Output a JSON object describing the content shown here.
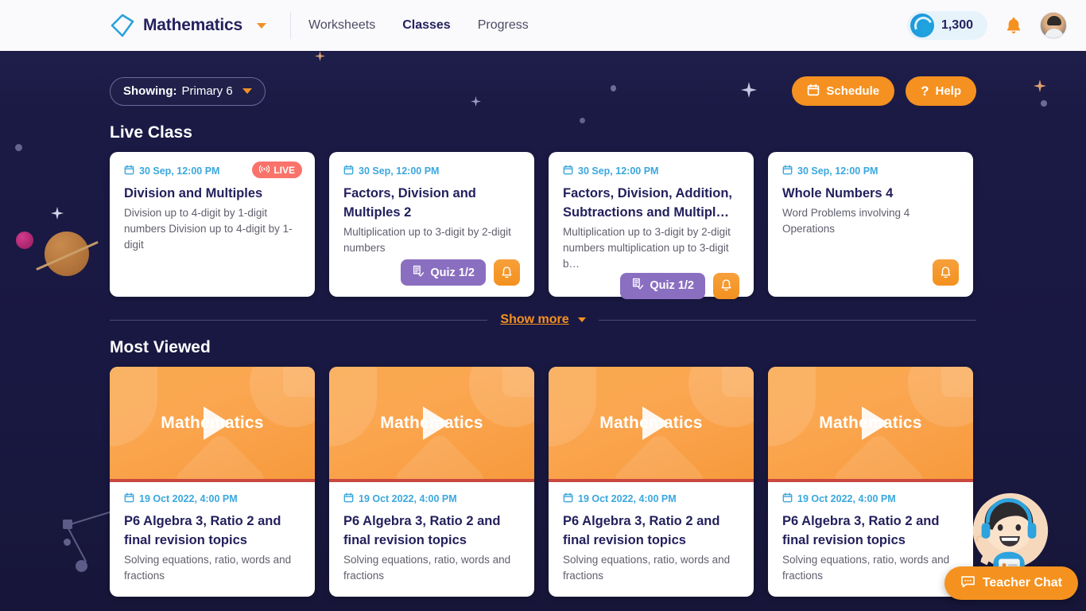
{
  "header": {
    "logo_icon": "diamond-logo-icon",
    "brand_title": "Mathematics",
    "brand_caret_icon": "chevron-down-icon",
    "nav": [
      {
        "label": "Worksheets",
        "active": false
      },
      {
        "label": "Classes",
        "active": true
      },
      {
        "label": "Progress",
        "active": false
      }
    ],
    "coins": {
      "icon": "coin-icon",
      "value": "1,300"
    },
    "notifications_icon": "bell-icon",
    "avatar_icon": "user-avatar"
  },
  "toolbar": {
    "showing_label": "Showing:",
    "showing_value": "Primary 6",
    "showing_caret_icon": "chevron-down-icon",
    "schedule_label": "Schedule",
    "schedule_icon": "calendar-icon",
    "help_label": "Help",
    "help_icon": "question-mark-icon"
  },
  "live_section": {
    "title": "Live Class",
    "cards": [
      {
        "date": "30 Sep, 12:00 PM",
        "title": "Division and Multiples",
        "desc": "Division up to 4-digit by 1-digit numbers Division up to 4-digit by 1-digit",
        "live_badge": "LIVE",
        "quiz_label": null,
        "has_bell": false
      },
      {
        "date": "30 Sep, 12:00 PM",
        "title": "Factors, Division and Multiples 2",
        "desc": "Multiplication up to 3-digit by 2-digit numbers",
        "live_badge": null,
        "quiz_label": "Quiz 1/2",
        "has_bell": true
      },
      {
        "date": "30 Sep, 12:00 PM",
        "title": "Factors, Division, Addition, Subtractions and Multipl…",
        "desc": "Multiplication up to 3-digit by 2-digit numbers multiplication up to 3-digit b…",
        "live_badge": null,
        "quiz_label": "Quiz 1/2",
        "has_bell": true
      },
      {
        "date": "30 Sep, 12:00 PM",
        "title": "Whole Numbers 4",
        "desc": "Word Problems involving 4 Operations",
        "live_badge": null,
        "quiz_label": null,
        "has_bell": true
      }
    ]
  },
  "show_more": {
    "label": "Show more",
    "caret_icon": "chevron-down-icon"
  },
  "most_viewed": {
    "title": "Most Viewed",
    "cards": [
      {
        "thumb_text": "Mathematics",
        "date": "19 Oct 2022, 4:00 PM",
        "title": "P6 Algebra 3, Ratio 2 and final revision topics",
        "desc": "Solving equations, ratio, words and fractions"
      },
      {
        "thumb_text": "Mathematics",
        "date": "19 Oct 2022, 4:00 PM",
        "title": "P6 Algebra 3, Ratio 2 and final revision topics",
        "desc": "Solving equations, ratio, words and fractions"
      },
      {
        "thumb_text": "Mathematics",
        "date": "19 Oct 2022, 4:00 PM",
        "title": "P6 Algebra 3, Ratio 2 and final revision topics",
        "desc": "Solving equations, ratio, words and fractions"
      },
      {
        "thumb_text": "Mathematics",
        "date": "19 Oct 2022, 4:00 PM",
        "title": "P6 Algebra 3, Ratio 2 and final revision topics",
        "desc": "Solving equations, ratio, words and fractions"
      }
    ]
  },
  "teacher_chat": {
    "label": "Teacher Chat",
    "icon": "chat-bubble-icon",
    "avatar_icon": "teacher-character-icon"
  },
  "colors": {
    "page_bg": "#191842",
    "header_bg": "#fafafc",
    "accent_orange": "#f59121",
    "brand_navy": "#25215e",
    "live_red": "#f9736a",
    "quiz_purple": "#8a6fc0",
    "date_blue": "#3aa7de",
    "thumb_orange": "#f9a94e"
  }
}
